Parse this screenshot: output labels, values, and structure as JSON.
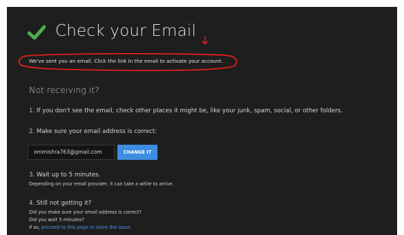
{
  "colors": {
    "panel_bg": "#1e1e1e",
    "check_green": "#4caf50",
    "annotation_red": "#e0201b",
    "button_blue": "#3d8de0",
    "link_blue": "#4a98e8"
  },
  "header": {
    "title": "Check your Email",
    "icon": "checkmark-icon"
  },
  "annotation": {
    "arrow_icon": "down-arrow-icon",
    "ring_icon": "highlight-ellipse"
  },
  "message": {
    "sent": "We've sent you an email. Click the link in the email to activate your account."
  },
  "help": {
    "heading": "Not receiving it?",
    "step1": {
      "num": "1.",
      "text": " If you don't see the email, check other places it might be, like your junk, spam, social, or other folders."
    },
    "step2": {
      "num": "2.",
      "text": " Make sure your email address is correct:"
    },
    "email": {
      "value": "ommishra763@gmail.com",
      "button_label": "CHANGE IT"
    },
    "step3": {
      "num": "3.",
      "text": " Wait up to 5 minutes.",
      "note": "Depending on your email provider, it can take a while to arrive."
    },
    "step4": {
      "num": "4.",
      "text": " Still not getting it?",
      "line1": "Did you make sure your email address is correct?",
      "line2": "Did you wait 5 minutes?",
      "line3_prefix": "If so, ",
      "line3_link": "proceed to this page to solve the issue",
      "line3_suffix": "."
    }
  }
}
